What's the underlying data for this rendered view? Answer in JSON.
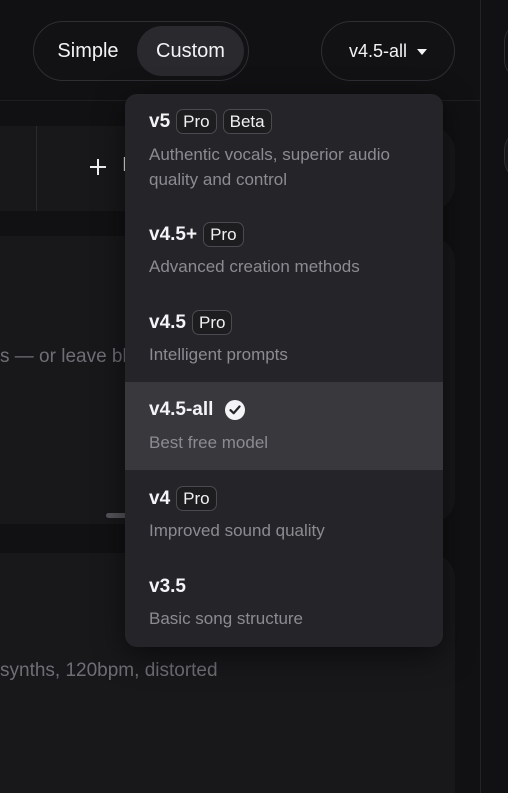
{
  "header": {
    "mode_toggle": {
      "simple_label": "Simple",
      "custom_label": "Custom",
      "active": "Custom"
    },
    "model_select": {
      "value": "v4.5-all"
    }
  },
  "background": {
    "add_button_label_fragment": "I",
    "lyrics_hint_fragment": "s — or leave bl",
    "style_hint_fragment": "synths, 120bpm, distorted"
  },
  "dropdown": {
    "options": [
      {
        "name": "v5",
        "badges": [
          "Pro",
          "Beta"
        ],
        "description": "Authentic vocals, superior audio quality and control",
        "selected": false
      },
      {
        "name": "v4.5+",
        "badges": [
          "Pro"
        ],
        "description": "Advanced creation methods",
        "selected": false
      },
      {
        "name": "v4.5",
        "badges": [
          "Pro"
        ],
        "description": "Intelligent prompts",
        "selected": false
      },
      {
        "name": "v4.5-all",
        "badges": [],
        "description": "Best free model",
        "selected": true
      },
      {
        "name": "v4",
        "badges": [
          "Pro"
        ],
        "description": "Improved sound quality",
        "selected": false
      },
      {
        "name": "v3.5",
        "badges": [],
        "description": "Basic song structure",
        "selected": false
      }
    ]
  },
  "colors": {
    "background": "#111113",
    "panel": "#18181b",
    "dropdown": "#252529",
    "selected_row": "#38383d",
    "muted_text": "#8b8b91"
  },
  "icons": {
    "caret": "caret-down-icon",
    "check": "check-circle-icon",
    "plus": "plus-icon"
  }
}
